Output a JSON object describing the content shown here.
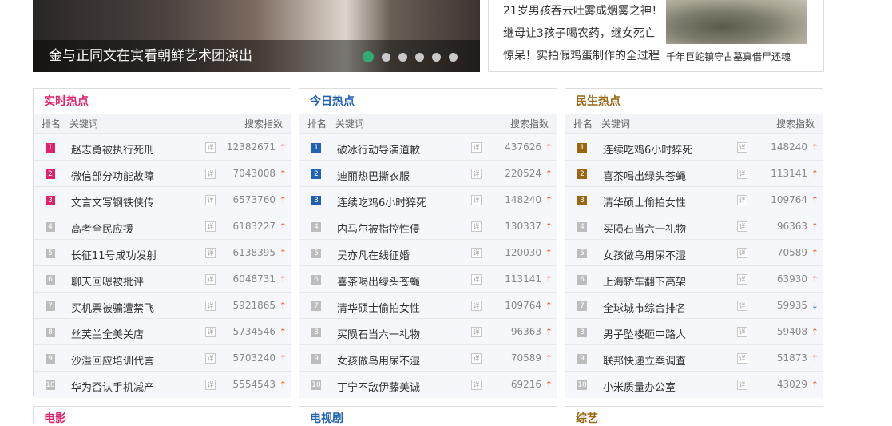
{
  "slider": {
    "caption": "金与正同文在寅看朝鲜艺术团演出",
    "dots": 6,
    "active": 0
  },
  "news": {
    "items": [
      "21岁男孩吞云吐雾成烟雾之神！",
      "继母让3孩子喝农药，继女死亡",
      "惊呆！实拍假鸡蛋制作的全过程"
    ],
    "pic_caption": "千年巨蛇镇守古墓真借尸还魂"
  },
  "colors": {
    "realtime": "#e0216b",
    "today": "#1f62b4",
    "livelihood": "#9a6611",
    "up_arrow": "#f25a2b",
    "down_arrow": "#3f7fd8"
  },
  "headers": {
    "rank": "排名",
    "keyword": "关键词",
    "index": "搜索指数",
    "detail": "详"
  },
  "panels": [
    {
      "title": "实时热点",
      "color": "#e0216b",
      "rows": [
        {
          "rank": "1",
          "kw": "赵志勇被执行死刑",
          "num": "12382671",
          "trend": "up"
        },
        {
          "rank": "2",
          "kw": "微信部分功能故障",
          "num": "7043008",
          "trend": "up"
        },
        {
          "rank": "3",
          "kw": "文言文写钢铁侠传",
          "num": "6573760",
          "trend": "up"
        },
        {
          "rank": "4",
          "kw": "高考全民应援",
          "num": "6183227",
          "trend": "up"
        },
        {
          "rank": "5",
          "kw": "长征11号成功发射",
          "num": "6138395",
          "trend": "up"
        },
        {
          "rank": "6",
          "kw": "聊天回嗯被批评",
          "num": "6048731",
          "trend": "up"
        },
        {
          "rank": "7",
          "kw": "买机票被骗遭禁飞",
          "num": "5921865",
          "trend": "up"
        },
        {
          "rank": "8",
          "kw": "丝芙兰全美关店",
          "num": "5734546",
          "trend": "up"
        },
        {
          "rank": "9",
          "kw": "沙溢回应培训代言",
          "num": "5703240",
          "trend": "up"
        },
        {
          "rank": "10",
          "kw": "华为否认手机减产",
          "num": "5554543",
          "trend": "up"
        }
      ],
      "bottom_title": "电影"
    },
    {
      "title": "今日热点",
      "color": "#1f62b4",
      "rows": [
        {
          "rank": "1",
          "kw": "破冰行动导演道歉",
          "num": "437626",
          "trend": "up"
        },
        {
          "rank": "2",
          "kw": "迪丽热巴撕衣服",
          "num": "220524",
          "trend": "up"
        },
        {
          "rank": "3",
          "kw": "连续吃鸡6小时猝死",
          "num": "148240",
          "trend": "up"
        },
        {
          "rank": "4",
          "kw": "内马尔被指控性侵",
          "num": "130337",
          "trend": "up"
        },
        {
          "rank": "5",
          "kw": "吴亦凡在线征婚",
          "num": "120030",
          "trend": "up"
        },
        {
          "rank": "6",
          "kw": "喜茶喝出绿头苍蝇",
          "num": "113141",
          "trend": "up"
        },
        {
          "rank": "7",
          "kw": "清华硕士偷拍女性",
          "num": "109764",
          "trend": "up"
        },
        {
          "rank": "8",
          "kw": "买陨石当六一礼物",
          "num": "96363",
          "trend": "up"
        },
        {
          "rank": "9",
          "kw": "女孩做鸟用尿不湿",
          "num": "70589",
          "trend": "up"
        },
        {
          "rank": "10",
          "kw": "丁宁不敌伊藤美诚",
          "num": "69216",
          "trend": "up"
        }
      ],
      "bottom_title": "电视剧"
    },
    {
      "title": "民生热点",
      "color": "#9a6611",
      "rows": [
        {
          "rank": "1",
          "kw": "连续吃鸡6小时猝死",
          "num": "148240",
          "trend": "up"
        },
        {
          "rank": "2",
          "kw": "喜茶喝出绿头苍蝇",
          "num": "113141",
          "trend": "up"
        },
        {
          "rank": "3",
          "kw": "清华硕士偷拍女性",
          "num": "109764",
          "trend": "up"
        },
        {
          "rank": "4",
          "kw": "买陨石当六一礼物",
          "num": "96363",
          "trend": "up"
        },
        {
          "rank": "5",
          "kw": "女孩做鸟用尿不湿",
          "num": "70589",
          "trend": "up"
        },
        {
          "rank": "6",
          "kw": "上海轿车翻下高架",
          "num": "63930",
          "trend": "up"
        },
        {
          "rank": "7",
          "kw": "全球城市综合排名",
          "num": "59935",
          "trend": "down"
        },
        {
          "rank": "8",
          "kw": "男子坠楼砸中路人",
          "num": "59408",
          "trend": "up"
        },
        {
          "rank": "9",
          "kw": "联邦快递立案调查",
          "num": "51873",
          "trend": "up"
        },
        {
          "rank": "10",
          "kw": "小米质量办公室",
          "num": "43029",
          "trend": "up"
        }
      ],
      "bottom_title": "综艺"
    }
  ]
}
